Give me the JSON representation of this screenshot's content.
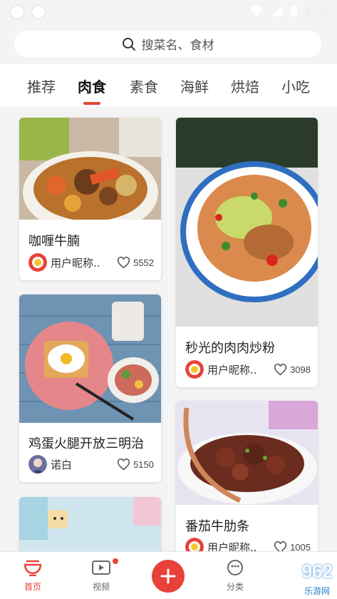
{
  "status_bar": {
    "time": "9:15"
  },
  "search": {
    "placeholder": "搜菜名、食材"
  },
  "tabs": [
    {
      "label": "推荐",
      "active": false
    },
    {
      "label": "肉食",
      "active": true
    },
    {
      "label": "素食",
      "active": false
    },
    {
      "label": "海鲜",
      "active": false
    },
    {
      "label": "烘焙",
      "active": false
    },
    {
      "label": "小吃",
      "active": false
    }
  ],
  "cards": [
    {
      "title": "咖喱牛腩",
      "author": "用户昵称..",
      "likes": "5552"
    },
    {
      "title": "秒光的肉肉炒粉",
      "author": "用户昵称..",
      "likes": "3098"
    },
    {
      "title": "鸡蛋火腿开放三明治",
      "author": "诺白",
      "likes": "5150"
    },
    {
      "title": "番茄牛肋条",
      "author": "用户昵称..",
      "likes": "1005"
    }
  ],
  "bottom_nav": {
    "home": "首页",
    "video": "视频",
    "category": "分类"
  },
  "watermark": {
    "brand": "962",
    "sub": "乐游网"
  },
  "colors": {
    "accent": "#e84437"
  }
}
